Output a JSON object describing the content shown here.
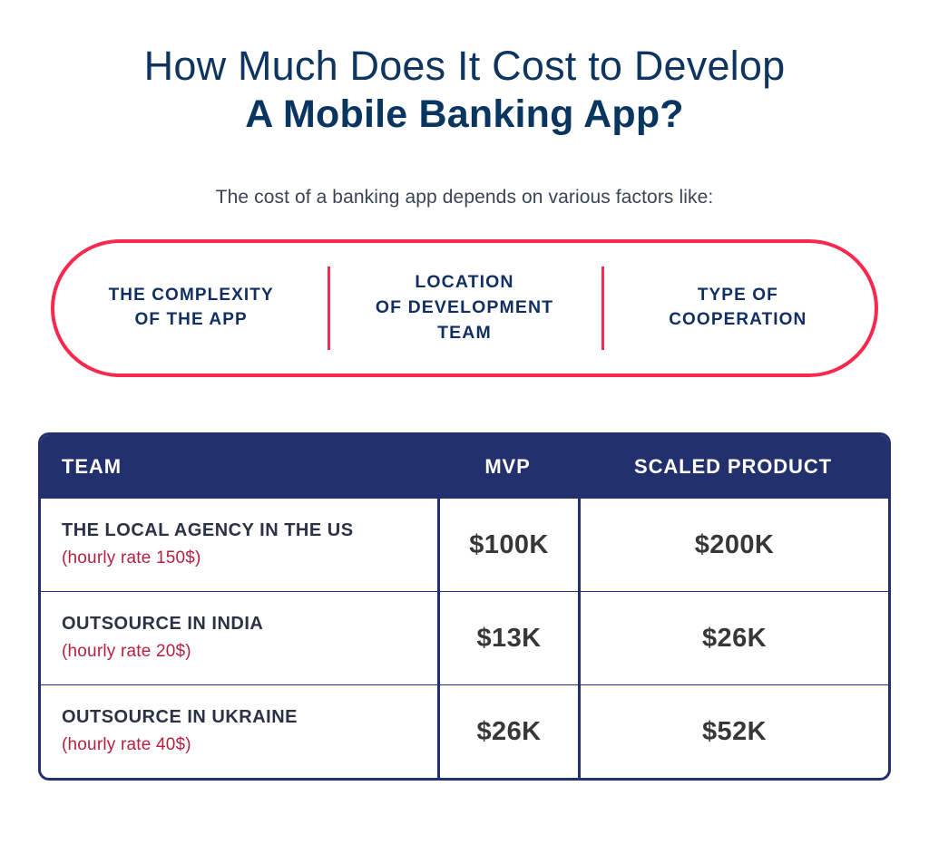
{
  "title": {
    "line1": "How Much Does It Cost to Develop",
    "line2": "A Mobile Banking App?"
  },
  "subtitle": "The cost of a banking app depends on various factors like:",
  "factors": {
    "items": [
      {
        "label": "THE COMPLEXITY\nOF THE APP"
      },
      {
        "label": "LOCATION\nOF DEVELOPMENT\nTEAM"
      },
      {
        "label": "TYPE OF\nCOOPERATION"
      }
    ],
    "border_color": "#F8294C"
  },
  "cost_table": {
    "header_bg": "#23306E",
    "columns": [
      "TEAM",
      "MVP",
      "SCALED PRODUCT"
    ],
    "rows": [
      {
        "team": "THE LOCAL AGENCY IN THE US",
        "rate": "(hourly rate 150$)",
        "mvp": "$100K",
        "scaled": "$200K"
      },
      {
        "team": "OUTSOURCE IN INDIA",
        "rate": "(hourly rate 20$)",
        "mvp": "$13K",
        "scaled": "$26K"
      },
      {
        "team": "OUTSOURCE IN UKRAINE",
        "rate": "(hourly rate 40$)",
        "mvp": "$26K",
        "scaled": "$52K"
      }
    ]
  }
}
